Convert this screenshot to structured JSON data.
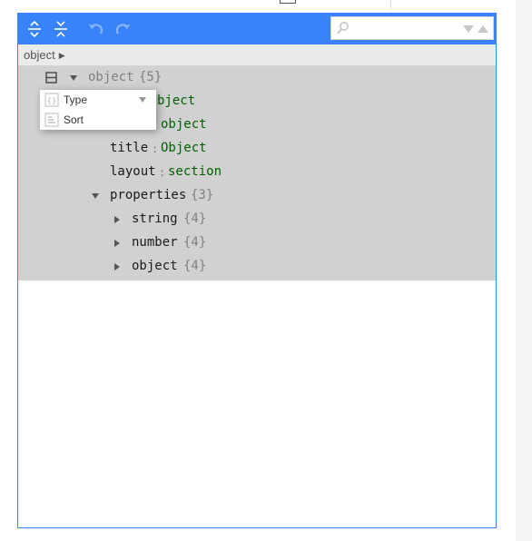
{
  "menu": {
    "expand_all_icon": "expand-all-icon",
    "collapse_all_icon": "collapse-all-icon",
    "undo_icon": "undo-icon",
    "redo_icon": "redo-icon"
  },
  "search": {
    "value": "",
    "placeholder": ""
  },
  "navigation": {
    "breadcrumb": "object"
  },
  "tree": {
    "root": {
      "field": "object",
      "count": "{5}"
    },
    "partial_rows": [
      {
        "value": "object",
        "visible_fragment": "bject"
      },
      {
        "value": "object"
      }
    ],
    "rows": [
      {
        "field": "title",
        "value": "Object"
      },
      {
        "field": "layout",
        "value": "section"
      }
    ],
    "properties": {
      "field": "properties",
      "count": "{3}"
    },
    "children": [
      {
        "field": "string",
        "count": "{4}"
      },
      {
        "field": "number",
        "count": "{4}"
      },
      {
        "field": "object",
        "count": "{4}"
      }
    ],
    "separator": ":"
  },
  "context_menu": {
    "items": [
      {
        "label": "Type",
        "icon": "type-icon",
        "has_submenu": true
      },
      {
        "label": "Sort",
        "icon": "sort-icon",
        "has_submenu": false
      }
    ]
  },
  "colors": {
    "accent": "#3883fa",
    "tree_background": "#d1d1d1",
    "value_text": "#006000",
    "count_text": "#808080"
  }
}
